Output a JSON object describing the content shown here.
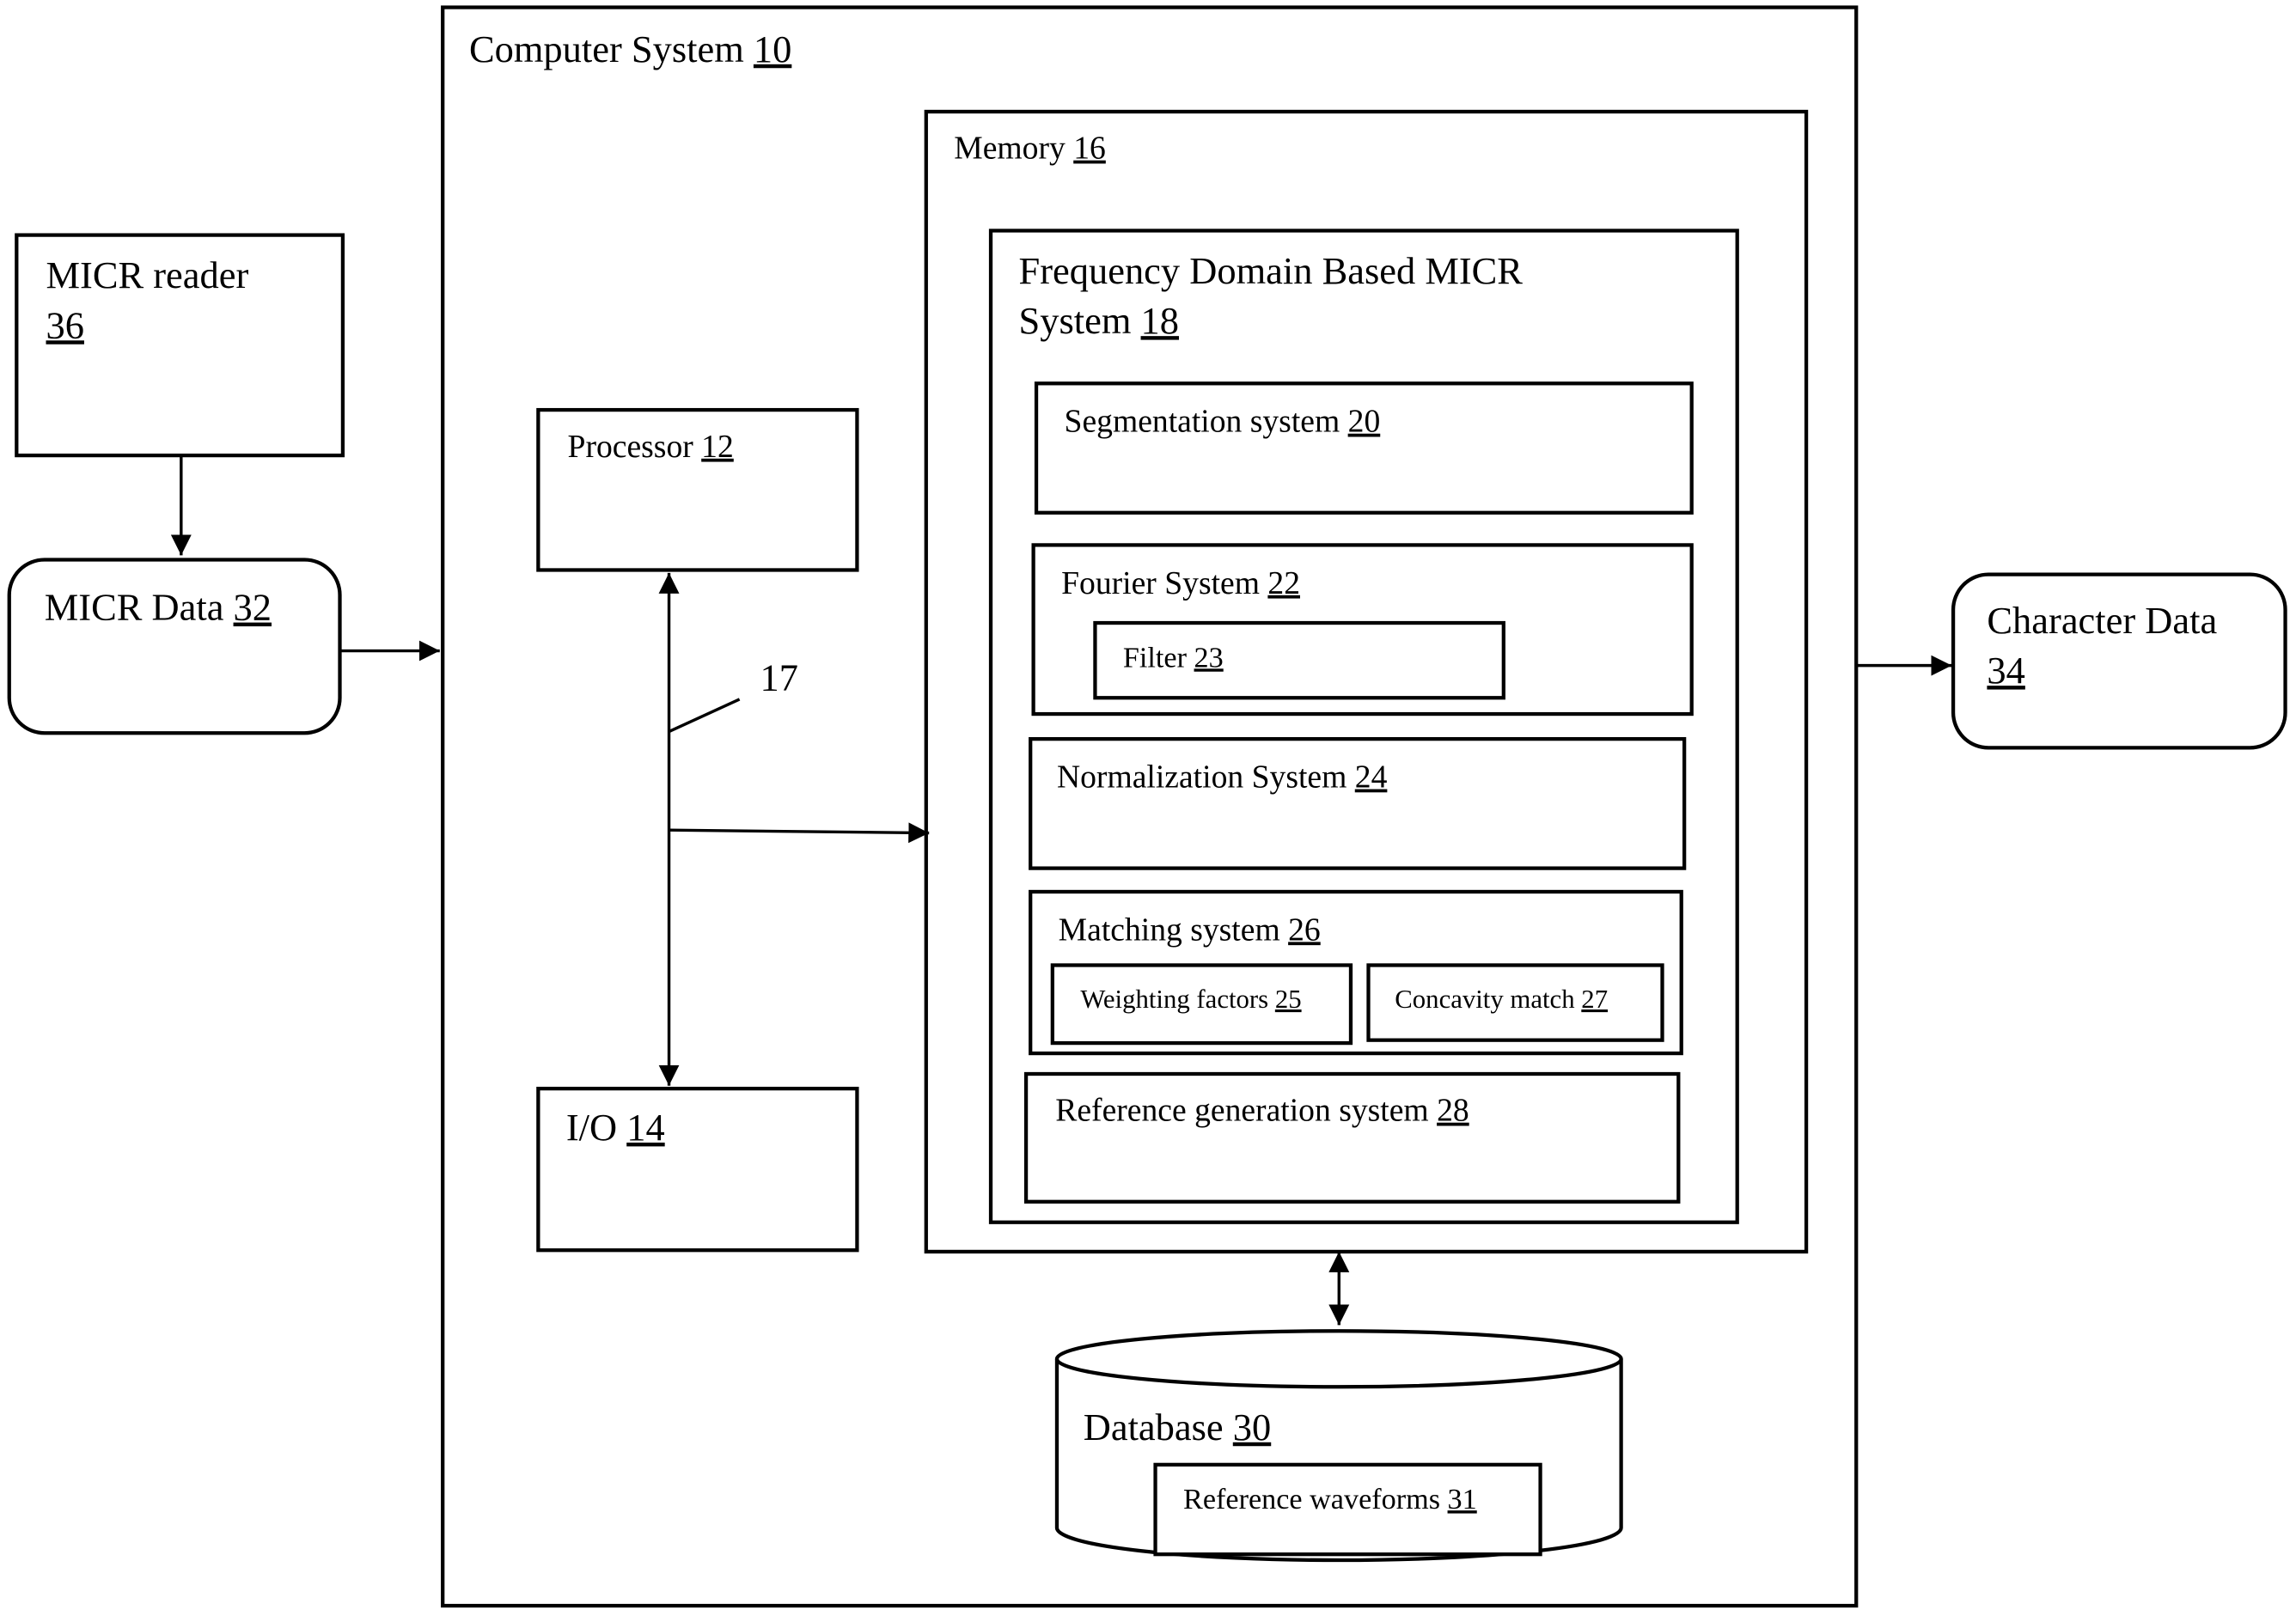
{
  "diagram": {
    "computer_system": {
      "label": "Computer System",
      "ref": "10"
    },
    "memory": {
      "label": "Memory",
      "ref": "16"
    },
    "micr_system": {
      "label_line1": "Frequency Domain Based MICR",
      "label_line2": "System",
      "ref": "18"
    },
    "segmentation": {
      "label": "Segmentation system",
      "ref": "20"
    },
    "fourier": {
      "label": "Fourier System",
      "ref": "22"
    },
    "filter": {
      "label": "Filter",
      "ref": "23"
    },
    "normalization": {
      "label": "Normalization System",
      "ref": "24"
    },
    "matching": {
      "label": "Matching system",
      "ref": "26"
    },
    "weighting": {
      "label": "Weighting factors",
      "ref": "25"
    },
    "concavity": {
      "label": "Concavity match",
      "ref": "27"
    },
    "reference_gen": {
      "label": "Reference generation system",
      "ref": "28"
    },
    "processor": {
      "label": "Processor",
      "ref": "12"
    },
    "io": {
      "label": "I/O",
      "ref": "14"
    },
    "bus": {
      "ref": "17"
    },
    "database": {
      "label": "Database",
      "ref": "30"
    },
    "waveforms": {
      "label": "Reference waveforms",
      "ref": "31"
    },
    "micr_reader": {
      "label": "MICR reader",
      "ref": "36"
    },
    "micr_data": {
      "label": "MICR Data",
      "ref": "32"
    },
    "character_data": {
      "label": "Character Data",
      "ref": "34"
    }
  }
}
